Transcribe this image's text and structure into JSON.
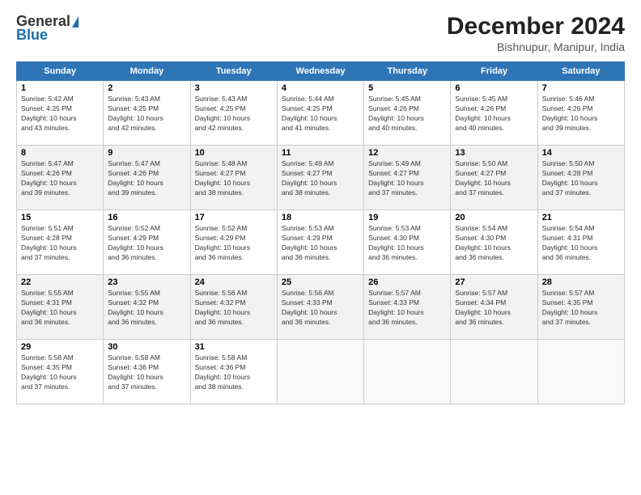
{
  "header": {
    "logo": {
      "line1": "General",
      "line2": "Blue"
    },
    "title": "December 2024",
    "subtitle": "Bishnupur, Manipur, India"
  },
  "columns": [
    "Sunday",
    "Monday",
    "Tuesday",
    "Wednesday",
    "Thursday",
    "Friday",
    "Saturday"
  ],
  "rows": [
    [
      {
        "day": "1",
        "info": "Sunrise: 5:42 AM\nSunset: 4:25 PM\nDaylight: 10 hours\nand 43 minutes."
      },
      {
        "day": "2",
        "info": "Sunrise: 5:43 AM\nSunset: 4:25 PM\nDaylight: 10 hours\nand 42 minutes."
      },
      {
        "day": "3",
        "info": "Sunrise: 5:43 AM\nSunset: 4:25 PM\nDaylight: 10 hours\nand 42 minutes."
      },
      {
        "day": "4",
        "info": "Sunrise: 5:44 AM\nSunset: 4:25 PM\nDaylight: 10 hours\nand 41 minutes."
      },
      {
        "day": "5",
        "info": "Sunrise: 5:45 AM\nSunset: 4:26 PM\nDaylight: 10 hours\nand 40 minutes."
      },
      {
        "day": "6",
        "info": "Sunrise: 5:45 AM\nSunset: 4:26 PM\nDaylight: 10 hours\nand 40 minutes."
      },
      {
        "day": "7",
        "info": "Sunrise: 5:46 AM\nSunset: 4:26 PM\nDaylight: 10 hours\nand 39 minutes."
      }
    ],
    [
      {
        "day": "8",
        "info": "Sunrise: 5:47 AM\nSunset: 4:26 PM\nDaylight: 10 hours\nand 39 minutes."
      },
      {
        "day": "9",
        "info": "Sunrise: 5:47 AM\nSunset: 4:26 PM\nDaylight: 10 hours\nand 39 minutes."
      },
      {
        "day": "10",
        "info": "Sunrise: 5:48 AM\nSunset: 4:27 PM\nDaylight: 10 hours\nand 38 minutes."
      },
      {
        "day": "11",
        "info": "Sunrise: 5:49 AM\nSunset: 4:27 PM\nDaylight: 10 hours\nand 38 minutes."
      },
      {
        "day": "12",
        "info": "Sunrise: 5:49 AM\nSunset: 4:27 PM\nDaylight: 10 hours\nand 37 minutes."
      },
      {
        "day": "13",
        "info": "Sunrise: 5:50 AM\nSunset: 4:27 PM\nDaylight: 10 hours\nand 37 minutes."
      },
      {
        "day": "14",
        "info": "Sunrise: 5:50 AM\nSunset: 4:28 PM\nDaylight: 10 hours\nand 37 minutes."
      }
    ],
    [
      {
        "day": "15",
        "info": "Sunrise: 5:51 AM\nSunset: 4:28 PM\nDaylight: 10 hours\nand 37 minutes."
      },
      {
        "day": "16",
        "info": "Sunrise: 5:52 AM\nSunset: 4:29 PM\nDaylight: 10 hours\nand 36 minutes."
      },
      {
        "day": "17",
        "info": "Sunrise: 5:52 AM\nSunset: 4:29 PM\nDaylight: 10 hours\nand 36 minutes."
      },
      {
        "day": "18",
        "info": "Sunrise: 5:53 AM\nSunset: 4:29 PM\nDaylight: 10 hours\nand 36 minutes."
      },
      {
        "day": "19",
        "info": "Sunrise: 5:53 AM\nSunset: 4:30 PM\nDaylight: 10 hours\nand 36 minutes."
      },
      {
        "day": "20",
        "info": "Sunrise: 5:54 AM\nSunset: 4:30 PM\nDaylight: 10 hours\nand 36 minutes."
      },
      {
        "day": "21",
        "info": "Sunrise: 5:54 AM\nSunset: 4:31 PM\nDaylight: 10 hours\nand 36 minutes."
      }
    ],
    [
      {
        "day": "22",
        "info": "Sunrise: 5:55 AM\nSunset: 4:31 PM\nDaylight: 10 hours\nand 36 minutes."
      },
      {
        "day": "23",
        "info": "Sunrise: 5:55 AM\nSunset: 4:32 PM\nDaylight: 10 hours\nand 36 minutes."
      },
      {
        "day": "24",
        "info": "Sunrise: 5:56 AM\nSunset: 4:32 PM\nDaylight: 10 hours\nand 36 minutes."
      },
      {
        "day": "25",
        "info": "Sunrise: 5:56 AM\nSunset: 4:33 PM\nDaylight: 10 hours\nand 36 minutes."
      },
      {
        "day": "26",
        "info": "Sunrise: 5:57 AM\nSunset: 4:33 PM\nDaylight: 10 hours\nand 36 minutes."
      },
      {
        "day": "27",
        "info": "Sunrise: 5:57 AM\nSunset: 4:34 PM\nDaylight: 10 hours\nand 36 minutes."
      },
      {
        "day": "28",
        "info": "Sunrise: 5:57 AM\nSunset: 4:35 PM\nDaylight: 10 hours\nand 37 minutes."
      }
    ],
    [
      {
        "day": "29",
        "info": "Sunrise: 5:58 AM\nSunset: 4:35 PM\nDaylight: 10 hours\nand 37 minutes."
      },
      {
        "day": "30",
        "info": "Sunrise: 5:58 AM\nSunset: 4:36 PM\nDaylight: 10 hours\nand 37 minutes."
      },
      {
        "day": "31",
        "info": "Sunrise: 5:58 AM\nSunset: 4:36 PM\nDaylight: 10 hours\nand 38 minutes."
      },
      {
        "day": "",
        "info": ""
      },
      {
        "day": "",
        "info": ""
      },
      {
        "day": "",
        "info": ""
      },
      {
        "day": "",
        "info": ""
      }
    ]
  ]
}
